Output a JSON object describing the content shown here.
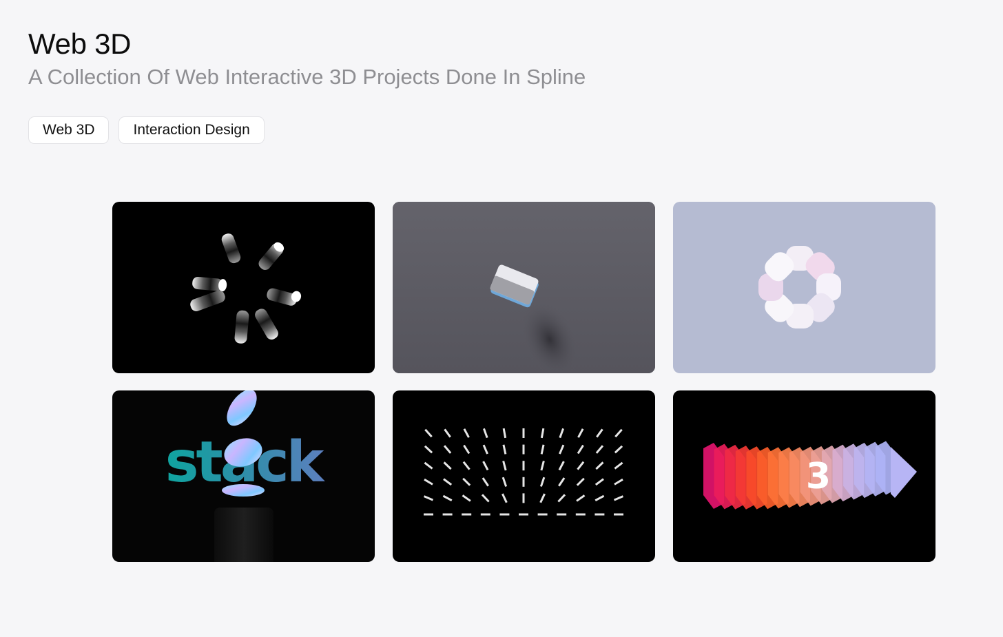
{
  "page": {
    "title": "Web 3D",
    "subtitle": "A Collection Of Web Interactive 3D Projects Done In Spline"
  },
  "tags": [
    {
      "label": "Web 3D"
    },
    {
      "label": "Interaction Design"
    }
  ],
  "projects": [
    {
      "thumbnail_icon": "rotating-cylinders-icon",
      "background": "#000000"
    },
    {
      "thumbnail_icon": "floating-cards-icon",
      "background": "#5b5a62"
    },
    {
      "thumbnail_icon": "pastel-ring-icon",
      "background": "#b5bbd2"
    },
    {
      "thumbnail_icon": "stack-coins-icon",
      "background": "#050505",
      "text": "stack"
    },
    {
      "thumbnail_icon": "line-grid-icon",
      "background": "#000000"
    },
    {
      "thumbnail_icon": "gradient-layers-icon",
      "background": "#000000",
      "text": "3"
    }
  ]
}
